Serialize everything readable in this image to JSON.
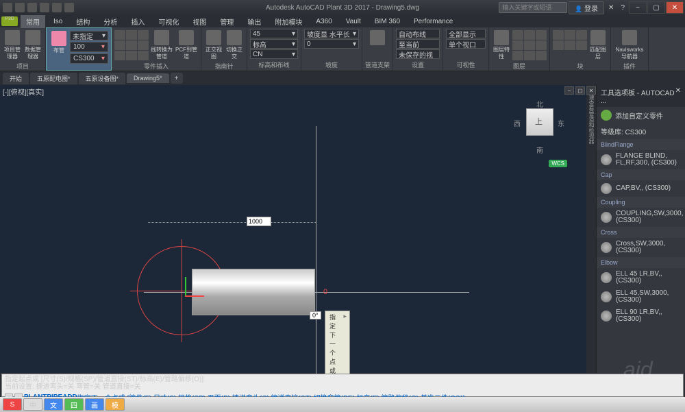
{
  "title": "Autodesk AutoCAD Plant 3D 2017 - Drawing5.dwg",
  "titlebar": {
    "search_placeholder": "输入关键字或短语",
    "login": "登录",
    "help_icon": "?"
  },
  "menubar": {
    "tabs": [
      "常用",
      "Iso",
      "结构",
      "分析",
      "插入",
      "可视化",
      "视图",
      "管理",
      "输出",
      "附加模块",
      "A360",
      "Vault",
      "BIM 360",
      "Performance"
    ],
    "active_index": 0
  },
  "ribbon": {
    "panels": {
      "project": {
        "label": "项目",
        "btns": [
          "项目管理器",
          "数据管理器"
        ]
      },
      "pipe": {
        "label": "布管",
        "dropdown1": "100",
        "dropdown2": "CS300",
        "unspec": "未指定"
      },
      "part": {
        "label": "零件插入",
        "btns": [
          "线转换为管道",
          "PCF到管道"
        ]
      },
      "compass": {
        "label": "指南针",
        "btns": [
          "正交视图",
          "切换正交"
        ]
      },
      "elev": {
        "label": "标高和布线",
        "angle": "45",
        "std": "标高",
        "cn": "CN"
      },
      "slope": {
        "label": "坡度",
        "drop": "坡度显 水平长",
        "angle": "0"
      },
      "pipesup": {
        "label": "管道支架"
      },
      "setup": {
        "label": "设置",
        "btns": [
          "自动布线",
          "至当前",
          "未保存的视"
        ]
      },
      "vis": {
        "label": "可视性",
        "btns": [
          "全部显示",
          "单个视口"
        ]
      },
      "layer": {
        "label": "图层",
        "btn": "图层特性"
      },
      "block": {
        "label": "块",
        "btn": "匹配图层"
      },
      "nav": {
        "label": "Navisworks 导航器",
        "btn": "插件"
      }
    }
  },
  "doctabs": {
    "tabs": [
      "开始",
      "五原配电图*",
      "五原设备图*",
      "Drawing5*"
    ],
    "active_index": 3
  },
  "canvas": {
    "view_label": "[-][俯视][真实]",
    "dim_value": "1000",
    "zero": "0",
    "angle": "0°",
    "tooltip": "指定下一个点或",
    "viewcube": {
      "n": "北",
      "s": "南",
      "e": "东",
      "w": "西",
      "top": "上",
      "wcs": "WCS"
    }
  },
  "palette": {
    "title": "工具选项板 - AUTOCAD ...",
    "custom": "添加自定义零件",
    "spec_label": "等级库: CS300",
    "sections": [
      {
        "name": "BlindFlange",
        "items": [
          "FLANGE BLIND, FL,RF,300, (CS300)"
        ]
      },
      {
        "name": "Cap",
        "items": [
          "CAP,BV,, (CS300)"
        ]
      },
      {
        "name": "Coupling",
        "items": [
          "COUPLING,SW,3000, (CS300)"
        ]
      },
      {
        "name": "Cross",
        "items": [
          "Cross,SW,3000, (CS300)"
        ]
      },
      {
        "name": "Elbow",
        "items": [
          "ELL 45 LR,BV,, (CS300)",
          "ELL 45,SW,3000, (CS300)",
          "ELL 90 LR,BV,, (CS300)"
        ]
      }
    ],
    "side_tab": "快速查看管道和检视器"
  },
  "cmdbar": {
    "line1": "指定起点或 [尺寸(S)/规格(SP)/管道直接(ST)/标高(E)/管路偏移(O)]:",
    "line2": "当前设置: 捷进弯头=关 弯管=关 管道直接=关",
    "prompt_cmd": "PLANTPIPEADD",
    "prompt_text": " 指定下一个点或 [管件(F) 尺寸(S) 规格(SP) 平面(P) 捷进弯头(C) 管道直接(ST) 切换弯管(BE) 标高(E) 管路偏移(O) 基准元件(CO)]:"
  },
  "taskbar": {
    "items": [
      "S",
      "中",
      "文",
      "四",
      "画",
      "模"
    ]
  },
  "chart_data": null
}
